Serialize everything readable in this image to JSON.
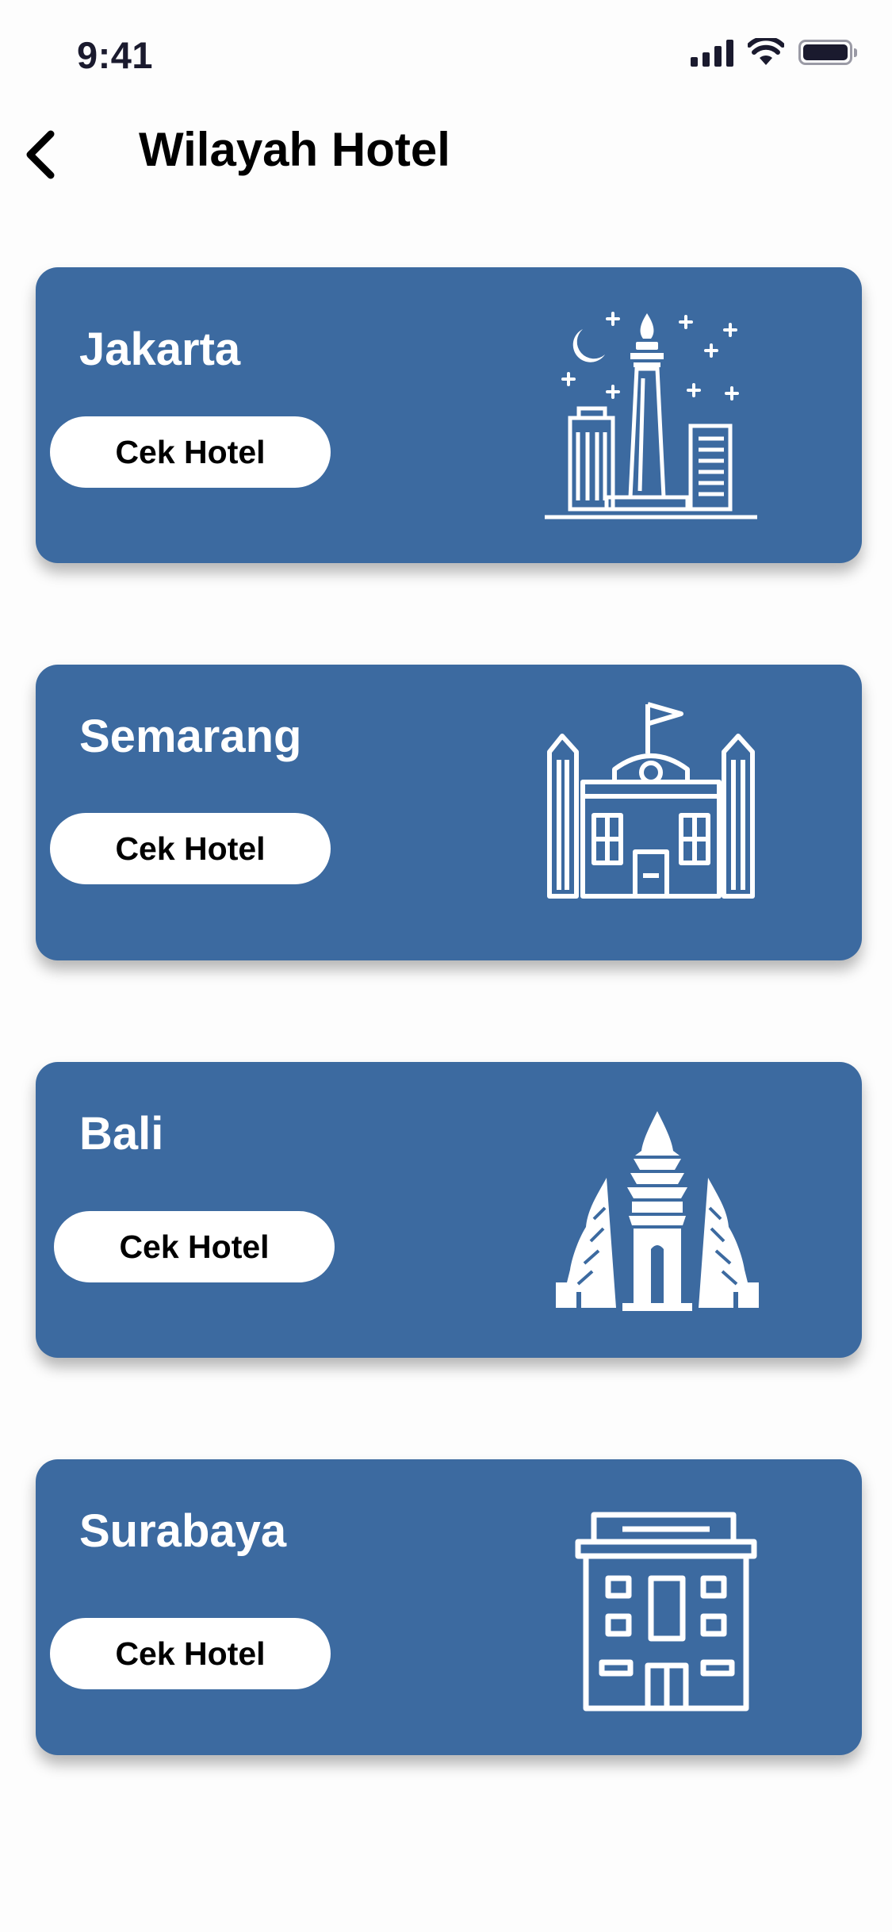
{
  "status_bar": {
    "time": "9:41"
  },
  "header": {
    "title": "Wilayah Hotel",
    "back_icon": "chevron-left-icon"
  },
  "cities": [
    {
      "name": "Jakarta",
      "button_label": "Cek Hotel",
      "icon": "monas-monument-icon"
    },
    {
      "name": "Semarang",
      "button_label": "Cek Hotel",
      "icon": "lawang-sewu-building-icon"
    },
    {
      "name": "Bali",
      "button_label": "Cek Hotel",
      "icon": "bali-temple-gate-icon"
    },
    {
      "name": "Surabaya",
      "button_label": "Cek Hotel",
      "icon": "hotel-building-icon"
    }
  ],
  "colors": {
    "card": "#3C6AA0",
    "button": "#FFFFFF",
    "title_text": "#000000",
    "card_text": "#FFFFFF"
  }
}
